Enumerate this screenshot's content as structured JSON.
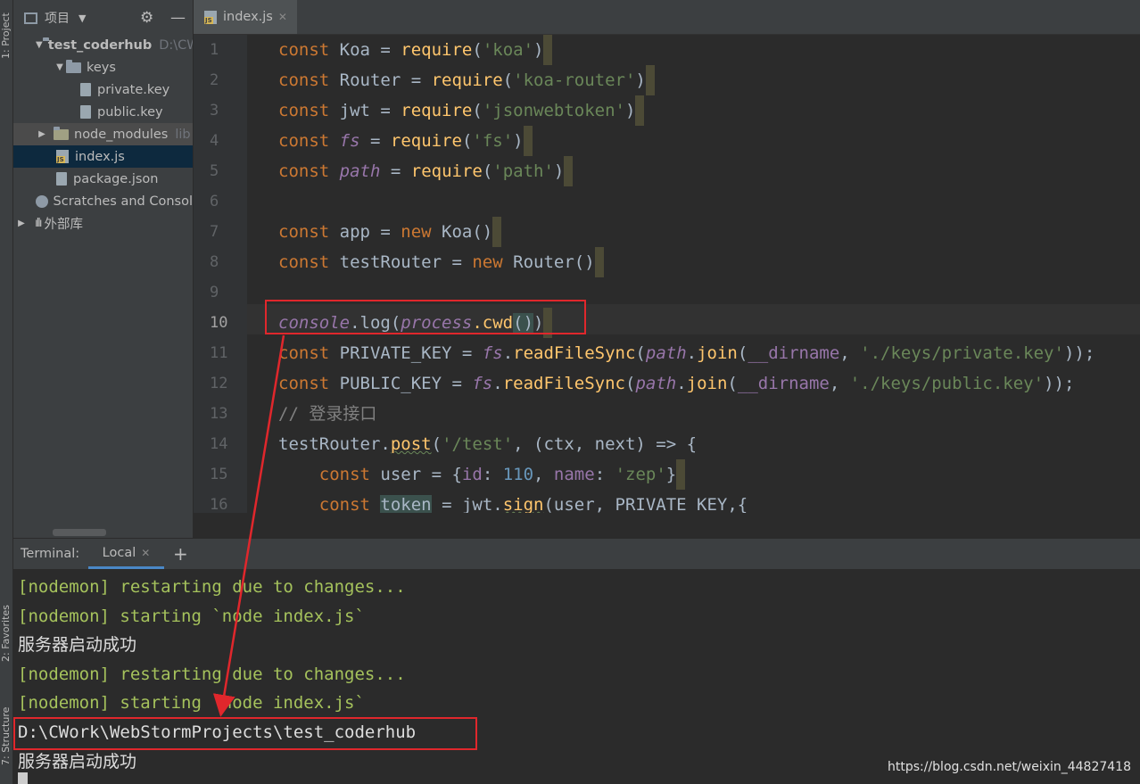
{
  "left_strip": {
    "project_label": "1: Project",
    "favorites_label": "2: Favorites",
    "structure_label": "7: Structure"
  },
  "sidebar": {
    "title": "项目",
    "tree": [
      {
        "label": "test_coderhub",
        "note": "D:\\CW"
      },
      {
        "label": "keys"
      },
      {
        "label": "private.key"
      },
      {
        "label": "public.key"
      },
      {
        "label": "node_modules",
        "note": "lib"
      },
      {
        "label": "index.js"
      },
      {
        "label": "package.json"
      },
      {
        "label": "Scratches and Consol"
      },
      {
        "label": "外部库"
      }
    ]
  },
  "editor": {
    "tab_label": "index.js",
    "line_numbers": [
      "1",
      "2",
      "3",
      "4",
      "5",
      "6",
      "7",
      "8",
      "9",
      "10",
      "11",
      "12",
      "13",
      "14",
      "15",
      "16"
    ],
    "lines": [
      [
        "const",
        " Koa = ",
        "require",
        "(",
        "'koa'",
        ")"
      ],
      [
        "const",
        " Router = ",
        "require",
        "(",
        "'koa-router'",
        ")"
      ],
      [
        "const",
        " jwt = ",
        "require",
        "(",
        "'jsonwebtoken'",
        ")"
      ],
      [
        "const",
        " ",
        "fs",
        " = ",
        "require",
        "(",
        "'fs'",
        ")"
      ],
      [
        "const",
        " ",
        "path",
        " = ",
        "require",
        "(",
        "'path'",
        ")"
      ],
      [],
      [
        "const",
        " app = ",
        "new",
        " Koa()"
      ],
      [
        "const",
        " testRouter = ",
        "new",
        " Router()"
      ],
      [],
      [
        "console",
        ".log(",
        "process",
        ".cwd",
        "()",
        ")"
      ],
      [
        "const",
        " PRIVATE_KEY = ",
        "fs",
        ".",
        "readFileSync",
        "(",
        "path",
        ".",
        "join",
        "(",
        "__dirname",
        ", ",
        "'./keys/private.key'",
        "));"
      ],
      [
        "const",
        " PUBLIC_KEY = ",
        "fs",
        ".",
        "readFileSync",
        "(",
        "path",
        ".",
        "join",
        "(",
        "__dirname",
        ", ",
        "'./keys/public.key'",
        "));"
      ],
      [
        "// 登录接口"
      ],
      [
        "testRouter.",
        "post",
        "(",
        "'/test'",
        ", (ctx, next) => {"
      ],
      [
        "    ",
        "const",
        " user = {",
        "id",
        ": ",
        "110",
        ", ",
        "name",
        ": ",
        "'zep'",
        "}"
      ],
      [
        "    ",
        "const",
        " ",
        "token",
        " = jwt.",
        "sign",
        "(user, PRIVATE_KEY,{"
      ]
    ]
  },
  "terminal": {
    "label": "Terminal:",
    "tab": "Local",
    "add": "+",
    "lines": [
      "[nodemon] restarting due to changes...",
      "[nodemon] starting `node index.js`",
      "服务器启动成功",
      "[nodemon] restarting due to changes...",
      "[nodemon] starting `node index.js`",
      "D:\\CWork\\WebStormProjects\\test_coderhub",
      "服务器启动成功"
    ]
  },
  "watermark": "https://blog.csdn.net/weixin_44827418",
  "colors": {
    "keyword": "#cc7832",
    "string": "#6a8759",
    "italic_global": "#9876aa",
    "function": "#ffc66d",
    "number": "#6897bb",
    "terminal_yellow": "#a5c25c",
    "annotation_red": "#e0272c"
  }
}
